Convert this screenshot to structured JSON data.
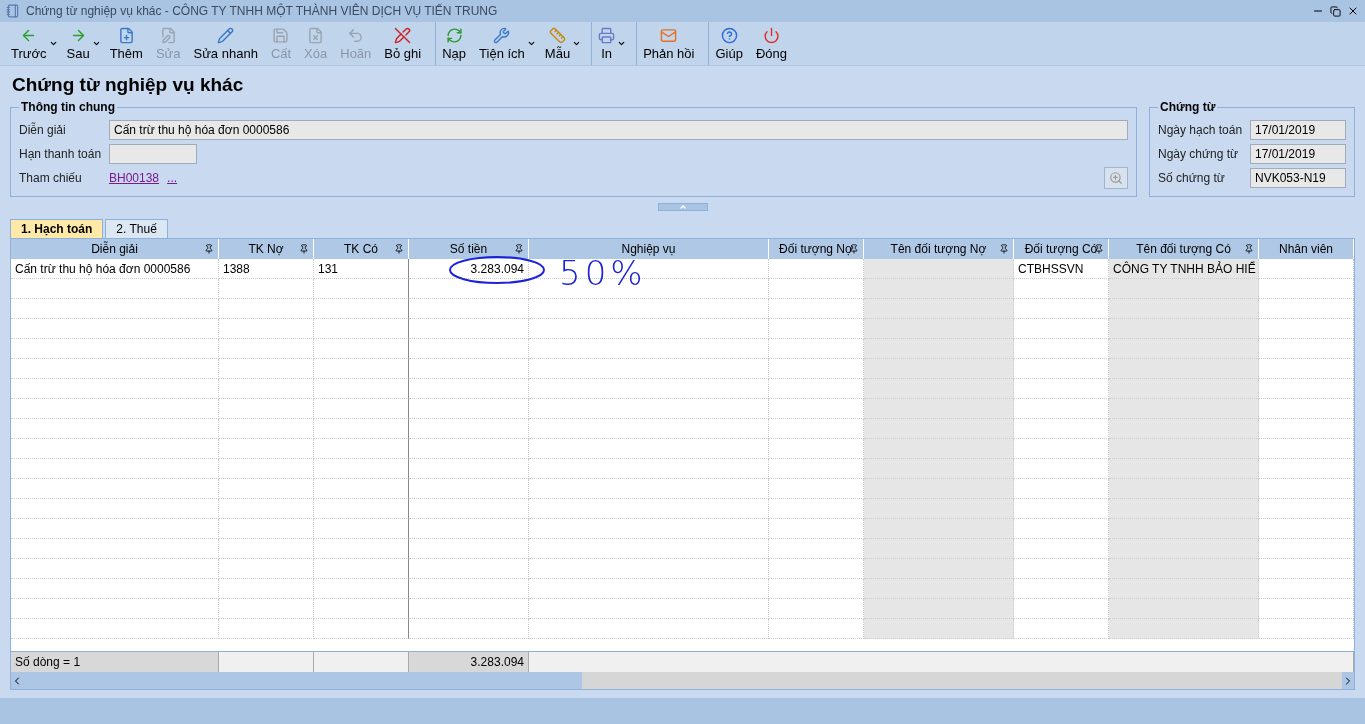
{
  "window": {
    "title": "Chứng từ nghiệp vụ khác - CÔNG TY TNHH MỘT THÀNH VIÊN DỊCH VỤ TIẾN TRUNG"
  },
  "toolbar": [
    {
      "label": "Trước",
      "disabled": false,
      "dropdown": true,
      "group_start": false
    },
    {
      "label": "Sau",
      "disabled": false,
      "dropdown": true,
      "group_start": false
    },
    {
      "label": "Thêm",
      "disabled": false,
      "dropdown": false,
      "group_start": false
    },
    {
      "label": "Sửa",
      "disabled": true,
      "dropdown": false,
      "group_start": false
    },
    {
      "label": "Sửa nhanh",
      "disabled": false,
      "dropdown": false,
      "group_start": false
    },
    {
      "label": "Cất",
      "disabled": true,
      "dropdown": false,
      "group_start": false
    },
    {
      "label": "Xóa",
      "disabled": true,
      "dropdown": false,
      "group_start": false
    },
    {
      "label": "Hoãn",
      "disabled": true,
      "dropdown": false,
      "group_start": false
    },
    {
      "label": "Bỏ ghi",
      "disabled": false,
      "dropdown": false,
      "group_start": false
    },
    {
      "label": "Nạp",
      "disabled": false,
      "dropdown": false,
      "group_start": true
    },
    {
      "label": "Tiện ích",
      "disabled": false,
      "dropdown": true,
      "group_start": false
    },
    {
      "label": "Mẫu",
      "disabled": false,
      "dropdown": true,
      "group_start": false
    },
    {
      "label": "In",
      "disabled": false,
      "dropdown": true,
      "group_start": true
    },
    {
      "label": "Phản hồi",
      "disabled": false,
      "dropdown": false,
      "group_start": true
    },
    {
      "label": "Giúp",
      "disabled": false,
      "dropdown": false,
      "group_start": true
    },
    {
      "label": "Đóng",
      "disabled": false,
      "dropdown": false,
      "group_start": false
    }
  ],
  "page_title": "Chứng từ nghiệp vụ khác",
  "general_info": {
    "legend": "Thông tin chung",
    "description": {
      "label": "Diễn giải",
      "value": "Cấn trừ thu hộ hóa đơn 0000586"
    },
    "due_date": {
      "label": "Hạn thanh toán"
    },
    "reference": {
      "label": "Tham chiếu",
      "link": "BH00138",
      "more": "..."
    }
  },
  "voucher": {
    "legend": "Chứng từ",
    "fields": [
      {
        "label": "Ngày hạch toán",
        "value": "17/01/2019"
      },
      {
        "label": "Ngày chứng từ",
        "value": "17/01/2019"
      },
      {
        "label": "Số chứng từ",
        "value": "NVK053-N19"
      }
    ]
  },
  "tabs": [
    {
      "label": "1. Hạch toán",
      "selected": true
    },
    {
      "label": "2. Thuế",
      "selected": false
    }
  ],
  "table": {
    "columns": [
      {
        "label": "Diễn giải",
        "pinned": true,
        "shaded": false,
        "kind": "text"
      },
      {
        "label": "TK Nợ",
        "pinned": true,
        "shaded": false,
        "kind": "text"
      },
      {
        "label": "TK Có",
        "pinned": true,
        "shaded": false,
        "kind": "text"
      },
      {
        "label": "Số tiền",
        "pinned": true,
        "shaded": false,
        "kind": "amount"
      },
      {
        "label": "Nghiệp vụ",
        "pinned": false,
        "shaded": false,
        "kind": "text"
      },
      {
        "label": "Đối tượng Nợ",
        "pinned": true,
        "shaded": false,
        "kind": "text"
      },
      {
        "label": "Tên đối tượng Nợ",
        "pinned": true,
        "shaded": true,
        "kind": "text"
      },
      {
        "label": "Đối tượng Có",
        "pinned": true,
        "shaded": false,
        "kind": "text"
      },
      {
        "label": "Tên đối tượng Có",
        "pinned": true,
        "shaded": true,
        "kind": "text"
      },
      {
        "label": "Nhân viên",
        "pinned": false,
        "shaded": false,
        "kind": "text"
      }
    ],
    "rows": [
      [
        "Cấn trừ thu hộ hóa đơn 0000586",
        "1388",
        "131",
        "3.283.094",
        null,
        null,
        null,
        "CTBHSSVN",
        "CÔNG TY TNHH BẢO HIỂ",
        null
      ]
    ],
    "footer": {
      "row_count": "Số dòng = 1",
      "amount_total": "3.283.094"
    }
  },
  "annotation": {
    "text": "50%"
  }
}
